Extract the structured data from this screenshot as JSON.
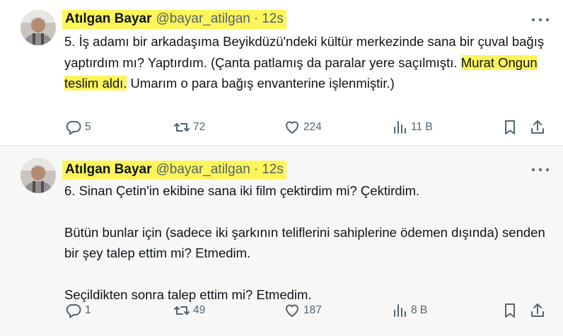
{
  "tweets": [
    {
      "author": {
        "name": "Atılgan Bayar",
        "handle": "@bayar_atilgan",
        "separator": "·",
        "time": "12s"
      },
      "body": {
        "p1_before": "5. İş adamı bir arkadaşıma Beyikdüzü'ndeki kültür merkezinde sana bir çuval bağış yaptırdım mı? Yaptırdım. (Çanta patlamış da paralar yere saçılmıştı. ",
        "p1_highlight": "Murat Ongun teslim aldı.",
        "p1_after": " Umarım o para bağış envanterine işlenmiştir.)"
      },
      "stats": {
        "replies": "5",
        "retweets": "72",
        "likes": "224",
        "views": "11 B"
      }
    },
    {
      "author": {
        "name": "Atılgan Bayar",
        "handle": "@bayar_atilgan",
        "separator": "·",
        "time": "12s"
      },
      "body": {
        "p1": "6. Sinan Çetin'in ekibine sana iki film çektirdim mi? Çektirdim.",
        "p2": "Bütün bunlar için (sadece iki şarkının teliflerini sahiplerine ödemen dışında) senden bir şey talep ettim mi? Etmedim.",
        "p3": "Seçildikten sonra talep ettim mi? Etmedim."
      },
      "stats": {
        "replies": "1",
        "retweets": "49",
        "likes": "187",
        "views": "8 B"
      }
    }
  ],
  "icons": {
    "reply": "reply-icon",
    "retweet": "retweet-icon",
    "like": "heart-icon",
    "views": "views-chart-icon",
    "bookmark": "bookmark-icon",
    "share": "share-icon",
    "more": "more-dots-icon"
  },
  "colors": {
    "text": "#0f1419",
    "muted": "#536471",
    "highlight": "#fdf55a",
    "tweet2_bg": "#f7f7f7"
  }
}
